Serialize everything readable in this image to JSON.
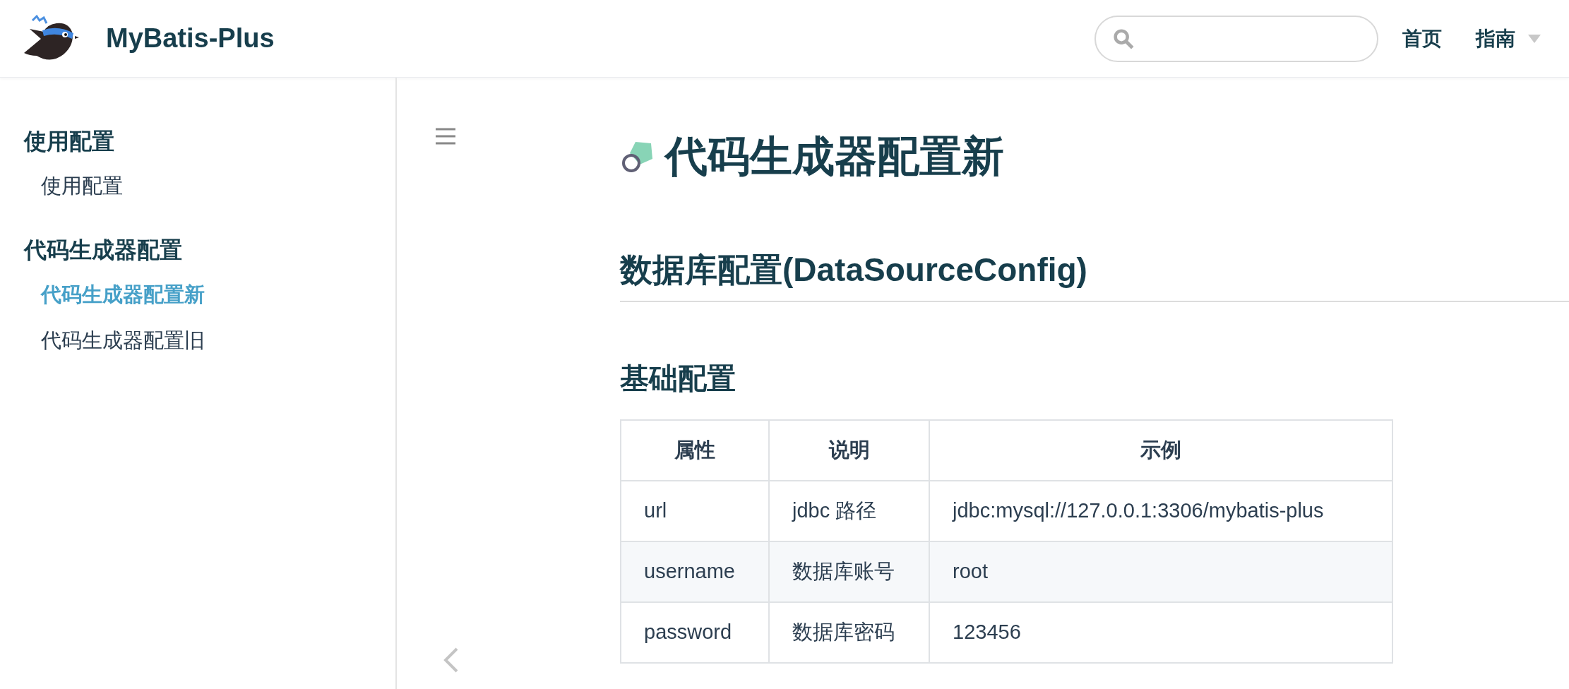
{
  "header": {
    "site_title": "MyBatis-Plus",
    "nav": [
      {
        "label": "首页",
        "dropdown": false
      },
      {
        "label": "指南",
        "dropdown": true
      }
    ]
  },
  "sidebar": {
    "groups": [
      {
        "title": "使用配置",
        "items": [
          {
            "label": "使用配置",
            "selected": false
          }
        ]
      },
      {
        "title": "代码生成器配置",
        "items": [
          {
            "label": "代码生成器配置新",
            "selected": true
          },
          {
            "label": "代码生成器配置旧",
            "selected": false
          }
        ]
      }
    ]
  },
  "content": {
    "title": "代码生成器配置新",
    "section": "数据库配置(DataSourceConfig)",
    "subsection": "基础配置",
    "table": {
      "columns": [
        "属性",
        "说明",
        "示例"
      ],
      "rows": [
        [
          "url",
          "jdbc 路径",
          "jdbc:mysql://127.0.0.1:3306/mybatis-plus"
        ],
        [
          "username",
          "数据库账号",
          "root"
        ],
        [
          "password",
          "数据库密码",
          "123456"
        ]
      ]
    }
  }
}
